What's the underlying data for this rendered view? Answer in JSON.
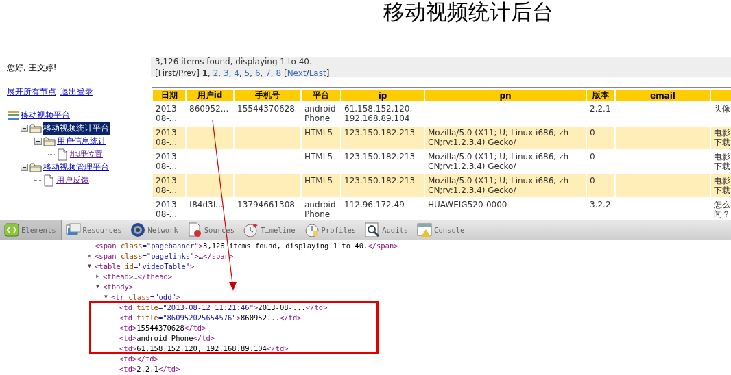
{
  "title": "移动视频统计后台",
  "greeting": "您好, 王文婷!",
  "actions": [
    {
      "label": "展开所有节点"
    },
    {
      "label": "退出登录"
    }
  ],
  "tree": [
    {
      "label": "移动视频平台",
      "kind": "root",
      "selected": false,
      "visited": false,
      "children": [
        {
          "label": "移动视频统计平台",
          "kind": "folder",
          "expanded": true,
          "selected": true,
          "visited": false,
          "children": [
            {
              "label": "用户信息统计",
              "kind": "folder",
              "expanded": true,
              "selected": false,
              "visited": false,
              "children": [
                {
                  "label": "地理位置",
                  "kind": "page",
                  "selected": false,
                  "visited": true
                }
              ]
            }
          ]
        },
        {
          "label": "移动视频管理平台",
          "kind": "folder",
          "expanded": true,
          "selected": false,
          "visited": false,
          "children": [
            {
              "label": "用户反馈",
              "kind": "page",
              "selected": false,
              "visited": true
            }
          ]
        }
      ]
    }
  ],
  "banner": "3,126 items found, displaying 1 to 40.",
  "pagination": {
    "first_prev": "[First/Prev]",
    "pages": [
      {
        "label": "1",
        "selected": true
      },
      {
        "label": "2",
        "selected": false
      },
      {
        "label": "3",
        "selected": false
      },
      {
        "label": "4",
        "selected": false
      },
      {
        "label": "5",
        "selected": false
      },
      {
        "label": "6",
        "selected": false
      },
      {
        "label": "7",
        "selected": false
      },
      {
        "label": "8",
        "selected": false
      }
    ],
    "separator": ",",
    "open": "[",
    "next": "Next",
    "slash": "/",
    "last": "Last",
    "close": "]"
  },
  "table": {
    "columns": [
      "日期",
      "用户id",
      "手机号",
      "平台",
      "ip",
      "pn",
      "版本",
      "email"
    ],
    "rows": [
      {
        "cells": [
          "2013-08-...",
          "860952...",
          "15544370628",
          "android Phone",
          "61.158.152.120, 192.168.89.104",
          null,
          "2.2.1",
          null,
          "头像"
        ]
      },
      {
        "cells": [
          "2013-08-...",
          null,
          null,
          "HTML5",
          "123.150.182.213",
          "Mozilla/5.0 (X11; U; Linux i686; zh-CN;rv:1.2.3.4) Gecko/",
          "0",
          null,
          "电影下载"
        ]
      },
      {
        "cells": [
          "2013-08-...",
          null,
          null,
          "HTML5",
          "123.150.182.213",
          "Mozilla/5.0 (X11; U; Linux i686; zh-CN;rv:1.2.3.4) Gecko/",
          "0",
          null,
          "电影下载"
        ]
      },
      {
        "cells": [
          "2013-08-...",
          null,
          null,
          "HTML5",
          "123.150.182.213",
          "Mozilla/5.0 (X11; U; Linux i686; zh-CN;rv:1.2.3.4) Gecko/",
          "0",
          null,
          "电影下载"
        ]
      },
      {
        "cells": [
          "2013-08-...",
          "f84d3f...",
          "13794661308",
          "android Phone",
          "112.96.172.49",
          "HUAWEIG520-0000",
          "3.2.2",
          null,
          "怎么闻？"
        ]
      }
    ]
  },
  "devtools": {
    "tabs": [
      {
        "label": "Elements",
        "kind": "elements",
        "selected": true
      },
      {
        "label": "Resources",
        "kind": "resources",
        "selected": false
      },
      {
        "label": "Network",
        "kind": "network",
        "selected": false
      },
      {
        "label": "Sources",
        "kind": "sources",
        "selected": false
      },
      {
        "label": "Timeline",
        "kind": "timeline",
        "selected": false
      },
      {
        "label": "Profiles",
        "kind": "profiles",
        "selected": false
      },
      {
        "label": "Audits",
        "kind": "audits",
        "selected": false
      },
      {
        "label": "Console",
        "kind": "console",
        "selected": false
      }
    ],
    "dom": [
      {
        "text": "<span class=\"pagebanner\">3,126 items found, displaying 1 to 40.</span>"
      },
      {
        "text": "<span class=\"pagelinks\">…</span>",
        "toggle": "▶",
        "expanded": false
      },
      {
        "text": "<table id=\"videoTable\">",
        "toggle": "▼",
        "expanded": true,
        "children": [
          {
            "text": "<thead>…</thead>",
            "toggle": "▶",
            "expanded": false
          },
          {
            "text": "<tbody>",
            "toggle": "▼",
            "expanded": true,
            "children": [
              {
                "text": "<tr class=\"odd\">",
                "toggle": "▼",
                "expanded": true,
                "children": [
                  {
                    "text": "<td title=\"2013-08-12 11:21:46\">2013-08-...</td>"
                  },
                  {
                    "text": "<td title=\"860952025654576\">860952...</td>"
                  },
                  {
                    "text": "<td>15544370628</td>"
                  },
                  {
                    "text": "<td>android Phone</td>"
                  },
                  {
                    "text": "<td>61.158.152.120, 192.168.89.104</td>"
                  },
                  {
                    "text": "<td></td>"
                  },
                  {
                    "text": "<td>2.2.1</td>"
                  }
                ]
              }
            ]
          }
        ]
      }
    ]
  }
}
